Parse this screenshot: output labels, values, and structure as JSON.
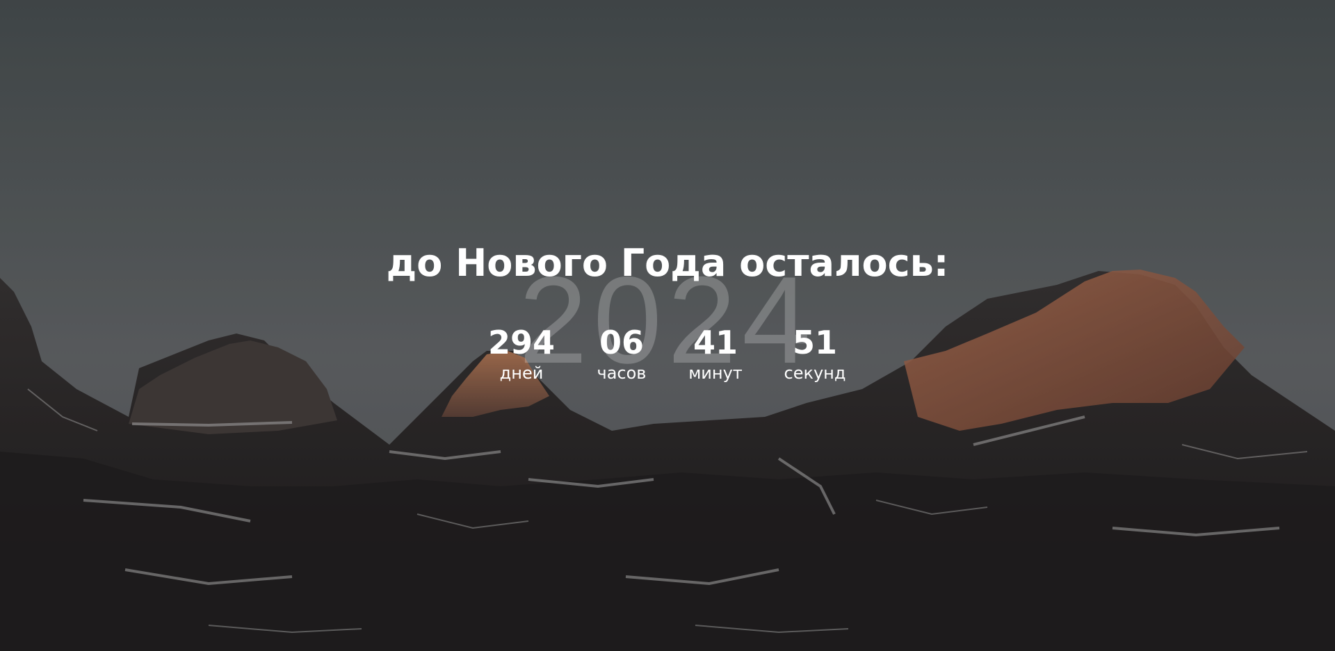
{
  "page": {
    "title": "до Нового Года осталось:",
    "year_watermark": "2024",
    "background_image": "mountain-range-at-dusk",
    "accent_color": "#ffffff"
  },
  "countdown": [
    {
      "value": "294",
      "label": "дней"
    },
    {
      "value": "06",
      "label": "часов"
    },
    {
      "value": "41",
      "label": "минут"
    },
    {
      "value": "51",
      "label": "секунд"
    }
  ]
}
